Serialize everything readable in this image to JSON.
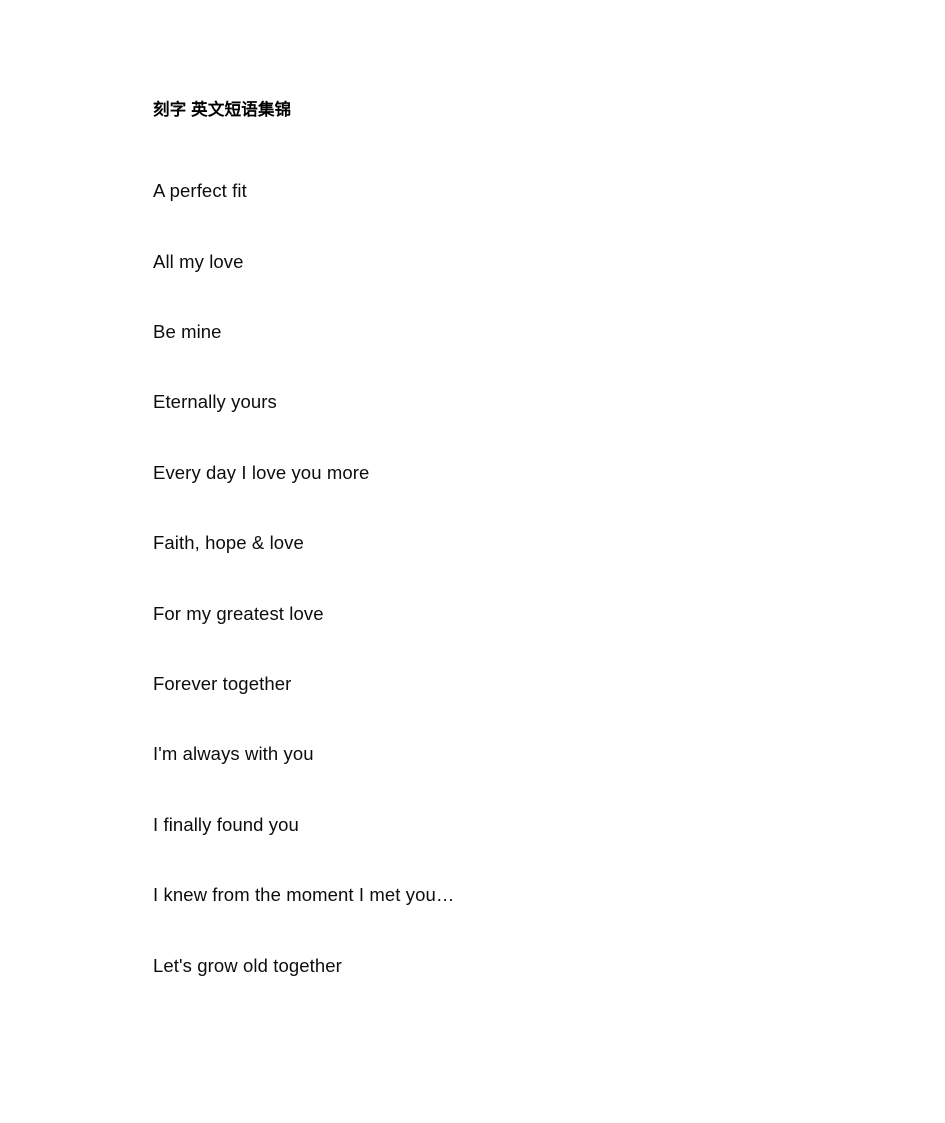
{
  "document": {
    "title": "刻字 英文短语集锦",
    "phrases": [
      {
        "text": "A perfect fit"
      },
      {
        "text": "All my love"
      },
      {
        "text": "Be mine"
      },
      {
        "text": "Eternally yours"
      },
      {
        "text": "Every day I love you more"
      },
      {
        "text": "Faith, hope & love"
      },
      {
        "text": "For my greatest love"
      },
      {
        "text": "Forever together"
      },
      {
        "text": "I'm always with you"
      },
      {
        "text": "I finally found you"
      },
      {
        "text": "I knew from the moment I met you…"
      },
      {
        "text": "Let's grow old together"
      }
    ]
  },
  "style": {
    "page_background": "#ffffff",
    "title_color": "#000000",
    "body_text_color": "#0d0d0d"
  }
}
